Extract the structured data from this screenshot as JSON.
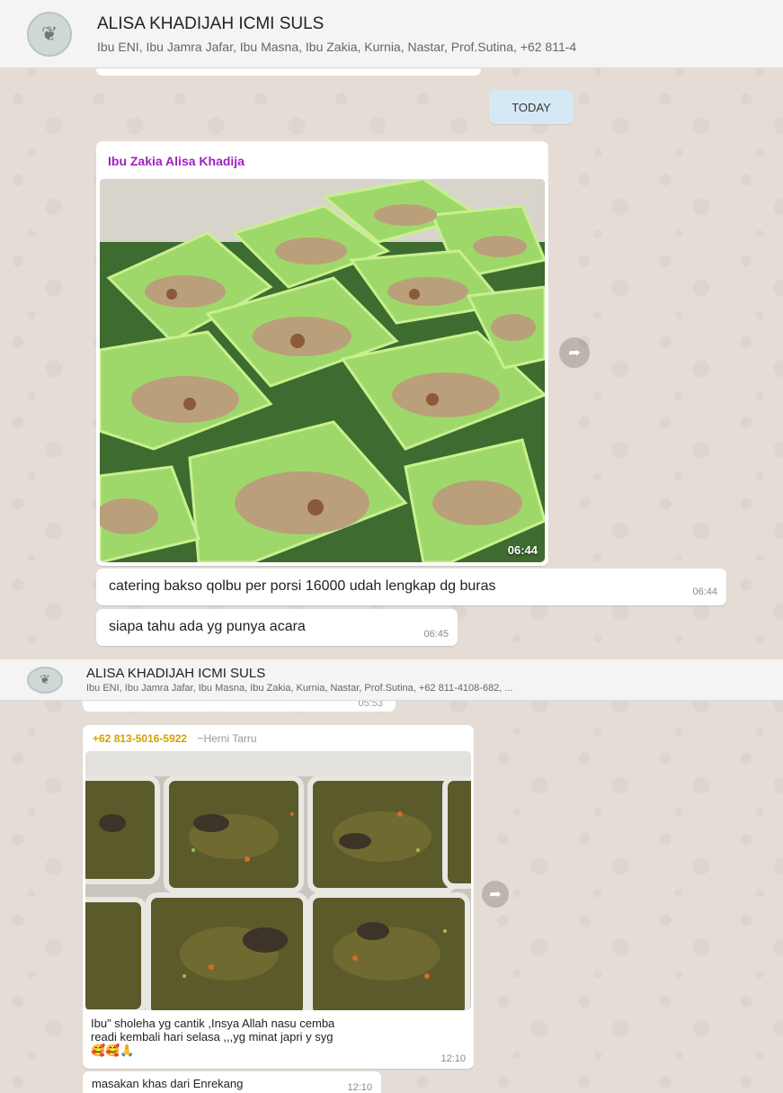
{
  "panel1": {
    "group": {
      "title": "ALISA KHADIJAH ICMI SULS",
      "members": "Ibu ENI, Ibu Jamra Jafar, Ibu Masna, Ibu Zakia, Kurnia, Nastar, Prof.Sutina, +62 811-4"
    },
    "date_separator": "TODAY",
    "image_message": {
      "sender": "Ibu Zakia Alisa Khadija",
      "time": "06:44"
    },
    "messages": [
      {
        "text": "catering bakso qolbu per porsi 16000 udah lengkap dg buras",
        "time": "06:44"
      },
      {
        "text": "siapa tahu ada yg punya acara",
        "time": "06:45"
      }
    ]
  },
  "panel2": {
    "group": {
      "title": "ALISA KHADIJAH ICMI SULS",
      "members": "Ibu ENI, Ibu Jamra Jafar, Ibu Masna, Ibu Zakia, Kurnia, Nastar, Prof.Sutina, +62 811-4108-682, ..."
    },
    "cut_time": "05:53",
    "image_message": {
      "sender_phone": "+62 813-5016-5922",
      "sender_name": "~Herni Tarru",
      "caption_line1": "Ibu\" sholeha yg cantik ,Insya Allah nasu cemba",
      "caption_line2": "readi kembali hari selasa ,,,yg minat japri y syg",
      "caption_emoji": "🥰🥰🙏",
      "time": "12:10"
    },
    "messages": [
      {
        "text": "masakan khas dari Enrekang",
        "time": "12:10"
      }
    ]
  },
  "colors": {
    "chat_background": "#e5ddd5",
    "sender1": "#a020c0",
    "sender2_phone": "#d4a000",
    "date_pill": "#d5e9f5"
  },
  "icons": [
    "group-avatar-icon",
    "forward-icon"
  ]
}
